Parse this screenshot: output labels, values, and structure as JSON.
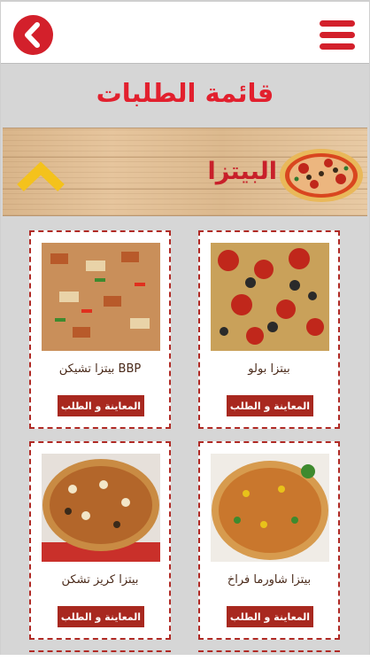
{
  "header": {
    "back_icon": "chevron-left-icon",
    "menu_icon": "hamburger-menu-icon"
  },
  "page_title": "قائمة الطلبات",
  "category": {
    "label": "البيتزا",
    "toggle_icon": "chevron-up-icon"
  },
  "colors": {
    "brand_red": "#d3202b",
    "button_brown": "#a8281f",
    "card_border": "#b02a25"
  },
  "products": [
    {
      "name": "بيتزا بولو",
      "button": "المعاينة و الطلب"
    },
    {
      "name": "بيتزا تشيكن BBP",
      "button": "المعاينة و الطلب"
    },
    {
      "name": "بيتزا شاورما فراخ",
      "button": "المعاينة و الطلب"
    },
    {
      "name": "بيتزا كريز تشكن",
      "button": "المعاينة و الطلب"
    }
  ]
}
